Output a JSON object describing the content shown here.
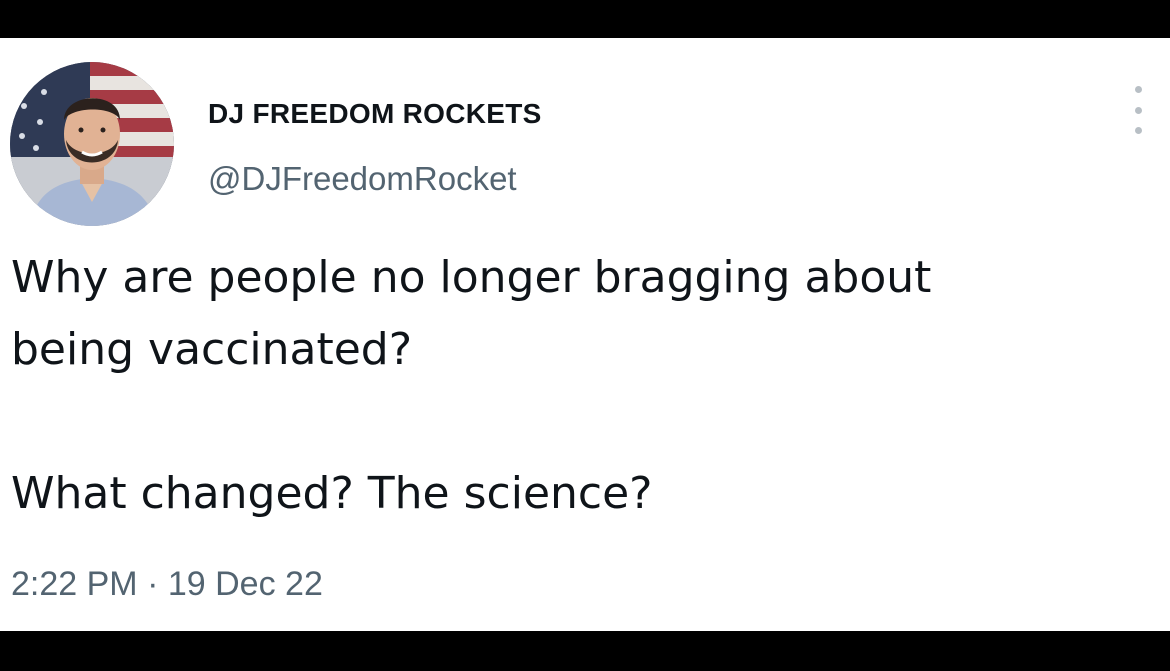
{
  "tweet": {
    "display_name": "DJ FREEDOM ROCKETS",
    "handle": "@DJFreedomRocket",
    "avatar_icon": "profile-photo",
    "more_icon": "more-options-icon",
    "text_lines": [
      "Why are people no longer bragging about",
      "being vaccinated?",
      "What changed? The science?"
    ],
    "time": "2:22 PM",
    "separator": "·",
    "date": "19 Dec 22"
  },
  "colors": {
    "text_primary": "#0f1419",
    "text_secondary": "#536471",
    "background": "#ffffff",
    "letterbox": "#000000"
  }
}
